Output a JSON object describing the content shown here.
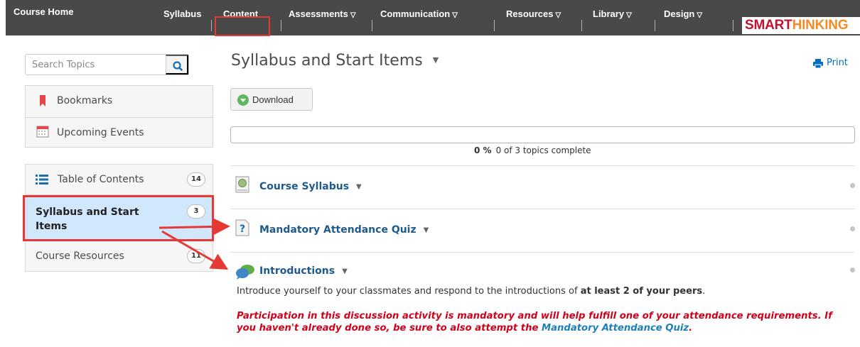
{
  "nav": {
    "home": "Course Home",
    "items": [
      {
        "label": "Syllabus",
        "has_menu": false
      },
      {
        "label": "Content",
        "has_menu": false,
        "highlighted": true
      },
      {
        "label": "Assessments",
        "has_menu": true
      },
      {
        "label": "Communication",
        "has_menu": true
      },
      {
        "label": "Resources",
        "has_menu": true
      },
      {
        "label": "Library",
        "has_menu": true
      },
      {
        "label": "Design",
        "has_menu": true
      }
    ],
    "dropdown_icon": "triangle-down-icon",
    "brand_part1": "SMART",
    "brand_part2": "HINKING",
    "bar_color": "#494949"
  },
  "sidebar": {
    "search_placeholder": "Search Topics",
    "search_icon": "search-icon",
    "bookmarks": {
      "label": "Bookmarks",
      "icon": "bookmark-icon"
    },
    "upcoming": {
      "label": "Upcoming Events",
      "icon": "calendar-icon"
    },
    "toc": [
      {
        "label": "Table of Contents",
        "count": "14",
        "icon": "list-icon",
        "active": false
      },
      {
        "label": "Syllabus and Start Items",
        "count": "3",
        "active": true
      },
      {
        "label": "Course Resources",
        "count": "11",
        "active": false
      }
    ]
  },
  "main": {
    "title": "Syllabus and Start Items",
    "print_label": "Print",
    "print_icon": "printer-icon",
    "download_label": "Download",
    "download_icon": "download-circle-icon",
    "progress": {
      "fraction_complete": 0,
      "percent": "0 %",
      "summary": "0 of 3 topics complete"
    },
    "items": [
      {
        "title": "Course Syllabus",
        "icon": "web-page-icon"
      },
      {
        "title": "Mandatory Attendance Quiz",
        "icon": "quiz-icon"
      },
      {
        "title": "Introductions",
        "icon": "discussion-icon"
      }
    ],
    "intro_text_1": "Introduce yourself to your classmates and respond to the introductions of ",
    "intro_text_bold": "at least 2 of your peers",
    "intro_text_end": ".",
    "warning_line1": "Participation in this discussion activity is mandatory and will help fulfill one of your attendance requirements. If",
    "warning_line2_start": "you haven't already done so, be sure to also attempt the ",
    "warning_link": "Mandatory Attendance Quiz",
    "warning_end": "."
  },
  "colors": {
    "accent_red": "#e53935",
    "link_blue": "#1f5a8c",
    "warning_red": "#d0021b",
    "active_row": "#d1e7fb"
  }
}
